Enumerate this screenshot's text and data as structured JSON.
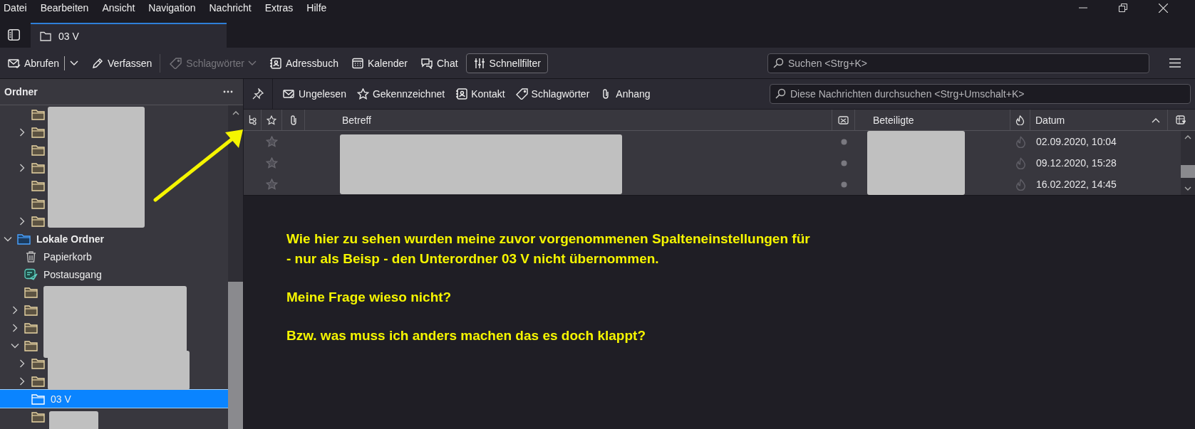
{
  "menu_bar": [
    {
      "label": "Datei"
    },
    {
      "label": "Bearbeiten"
    },
    {
      "label": "Ansicht"
    },
    {
      "label": "Navigation"
    },
    {
      "label": "Nachricht"
    },
    {
      "label": "Extras"
    },
    {
      "label": "Hilfe"
    }
  ],
  "tabs": [
    {
      "label": "03 V",
      "selected": true
    }
  ],
  "toolbar": {
    "buttons": [
      {
        "kind": "get",
        "label": "Abrufen",
        "disabled": false
      },
      {
        "kind": "compose",
        "label": "Verfassen",
        "disabled": false
      },
      {
        "kind": "tags",
        "label": "Schlagwörter",
        "disabled": true
      },
      {
        "kind": "addressbook",
        "label": "Adressbuch",
        "disabled": false
      },
      {
        "kind": "calendar",
        "label": "Kalender",
        "disabled": false
      },
      {
        "kind": "chat",
        "label": "Chat",
        "disabled": false
      },
      {
        "kind": "quickfilter",
        "label": "Schnellfilter",
        "disabled": false,
        "selected": true
      }
    ],
    "search": {
      "placeholder": "Suchen <Strg+K>"
    }
  },
  "folder_pane": {
    "title": "Ordner",
    "upper_folders": [
      {
        "kind": "folder",
        "selected": false
      },
      {
        "kind": "folder",
        "expanded": false,
        "selected": false
      },
      {
        "kind": "folder",
        "selected": false
      },
      {
        "kind": "folder",
        "expanded": false,
        "selected": false
      },
      {
        "kind": "folder",
        "selected": false
      },
      {
        "kind": "folder",
        "selected": false
      },
      {
        "kind": "folder",
        "expanded": false,
        "selected": false
      }
    ],
    "account": {
      "kind": "account",
      "name": "Lokale Ordner",
      "expanded": true,
      "selected": false,
      "children": [
        {
          "kind": "trash",
          "name": "Papierkorb",
          "selected": false
        },
        {
          "kind": "outbox",
          "name": "Postausgang",
          "selected": false
        },
        {
          "kind": "folder",
          "selected": false
        },
        {
          "kind": "folder",
          "expanded": false,
          "selected": false
        },
        {
          "kind": "folder",
          "expanded": false,
          "selected": false
        },
        {
          "kind": "folder",
          "expanded": true,
          "selected": false,
          "children": [
            {
              "kind": "folder",
              "expanded": false,
              "selected": false
            },
            {
              "kind": "folder",
              "expanded": false,
              "selected": false
            },
            {
              "kind": "folder",
              "name": "03 V",
              "selected": true
            },
            {
              "kind": "folder",
              "selected": false
            }
          ]
        }
      ]
    }
  },
  "quick_filter": {
    "buttons": [
      {
        "kind": "unread",
        "label": "Ungelesen",
        "selected": false
      },
      {
        "kind": "starred",
        "label": "Gekennzeichnet",
        "selected": false
      },
      {
        "kind": "contact",
        "label": "Kontakt",
        "selected": false
      },
      {
        "kind": "tags",
        "label": "Schlagwörter",
        "selected": false
      },
      {
        "kind": "attachment",
        "label": "Anhang",
        "selected": false
      }
    ],
    "search": {
      "placeholder": "Diese Nachrichten durchsuchen <Strg+Umschalt+K>"
    }
  },
  "message_list": {
    "columns": {
      "subject": "Betreff",
      "participants": "Beteiligte",
      "date": "Datum"
    },
    "rows": [
      {
        "flagged": false,
        "date": "02.09.2020, 10:04"
      },
      {
        "flagged": false,
        "date": "09.12.2020, 15:28"
      },
      {
        "flagged": false,
        "date": "16.02.2022, 14:45"
      }
    ]
  },
  "annotation": {
    "paragraphs": [
      "Wie hier zu sehen wurden meine zuvor vorgenommenen Spalteneinstellungen für\n- nur als Beisp - den Unterordner 03 V nicht übernommen.",
      "Meine Frage wieso nicht?",
      "Bzw. was muss ich anders machen das es doch klappt?"
    ]
  }
}
